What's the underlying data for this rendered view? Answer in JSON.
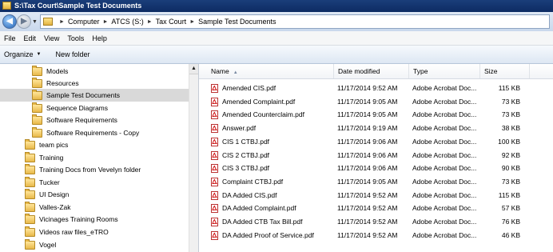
{
  "window": {
    "title": "S:\\Tax Court\\Sample Test Documents"
  },
  "address": {
    "parts": [
      "Computer",
      "ATCS (S:)",
      "Tax Court",
      "Sample Test Documents"
    ]
  },
  "menu": [
    "File",
    "Edit",
    "View",
    "Tools",
    "Help"
  ],
  "commands": {
    "organize": "Organize",
    "new_folder": "New folder"
  },
  "nav": {
    "items": [
      {
        "label": "Models"
      },
      {
        "label": "Resources"
      },
      {
        "label": "Sample Test Documents"
      },
      {
        "label": "Sequence Diagrams"
      },
      {
        "label": "Software Requirements"
      },
      {
        "label": "Software Requirements - Copy"
      },
      {
        "label": "team pics"
      },
      {
        "label": "Training"
      },
      {
        "label": "Training Docs from Vevelyn folder"
      },
      {
        "label": "Tucker"
      },
      {
        "label": "UI Design"
      },
      {
        "label": "Valles-Zak"
      },
      {
        "label": "Vicinages Training Rooms"
      },
      {
        "label": "Videos raw files_eTRO"
      },
      {
        "label": "Vogel"
      }
    ]
  },
  "columns": {
    "name": "Name",
    "date": "Date modified",
    "type": "Type",
    "size": "Size"
  },
  "files": [
    {
      "name": "Amended CIS.pdf",
      "date": "11/17/2014 9:52 AM",
      "type": "Adobe Acrobat Doc...",
      "size": "115 KB"
    },
    {
      "name": "Amended Complaint.pdf",
      "date": "11/17/2014 9:05 AM",
      "type": "Adobe Acrobat Doc...",
      "size": "73 KB"
    },
    {
      "name": "Amended Counterclaim.pdf",
      "date": "11/17/2014 9:05 AM",
      "type": "Adobe Acrobat Doc...",
      "size": "73 KB"
    },
    {
      "name": "Answer.pdf",
      "date": "11/17/2014 9:19 AM",
      "type": "Adobe Acrobat Doc...",
      "size": "38 KB"
    },
    {
      "name": "CIS 1 CTBJ.pdf",
      "date": "11/17/2014 9:06 AM",
      "type": "Adobe Acrobat Doc...",
      "size": "100 KB"
    },
    {
      "name": "CIS 2 CTBJ.pdf",
      "date": "11/17/2014 9:06 AM",
      "type": "Adobe Acrobat Doc...",
      "size": "92 KB"
    },
    {
      "name": "CIS 3 CTBJ.pdf",
      "date": "11/17/2014 9:06 AM",
      "type": "Adobe Acrobat Doc...",
      "size": "90 KB"
    },
    {
      "name": "Complaint CTBJ.pdf",
      "date": "11/17/2014 9:05 AM",
      "type": "Adobe Acrobat Doc...",
      "size": "73 KB"
    },
    {
      "name": "DA Added CIS.pdf",
      "date": "11/17/2014 9:52 AM",
      "type": "Adobe Acrobat Doc...",
      "size": "115 KB"
    },
    {
      "name": "DA Added Complaint.pdf",
      "date": "11/17/2014 9:52 AM",
      "type": "Adobe Acrobat Doc...",
      "size": "57 KB"
    },
    {
      "name": "DA Added CTB Tax Bill.pdf",
      "date": "11/17/2014 9:52 AM",
      "type": "Adobe Acrobat Doc...",
      "size": "76 KB"
    },
    {
      "name": "DA Added Proof of Service.pdf",
      "date": "11/17/2014 9:52 AM",
      "type": "Adobe Acrobat Doc...",
      "size": "46 KB"
    }
  ]
}
